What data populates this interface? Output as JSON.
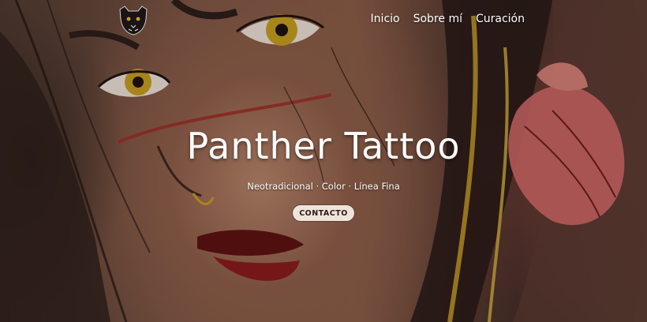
{
  "site": {
    "logo_icon": "panther-head-icon",
    "nav": [
      {
        "label": "Inicio"
      },
      {
        "label": "Sobre mí"
      },
      {
        "label": "Curación"
      }
    ]
  },
  "hero": {
    "title": "Panther Tattoo",
    "tagline": "Neotradicional · Color · Línea Fina",
    "cta_label": "CONTACTO",
    "background": "tattoo-artwork-woman-face"
  },
  "colors": {
    "text": "#ffffff",
    "button_bg": "#efe3da",
    "button_text": "#2a1d19",
    "lips": "#7a1518",
    "eye": "#c9a020",
    "red_line": "#a02a28"
  }
}
